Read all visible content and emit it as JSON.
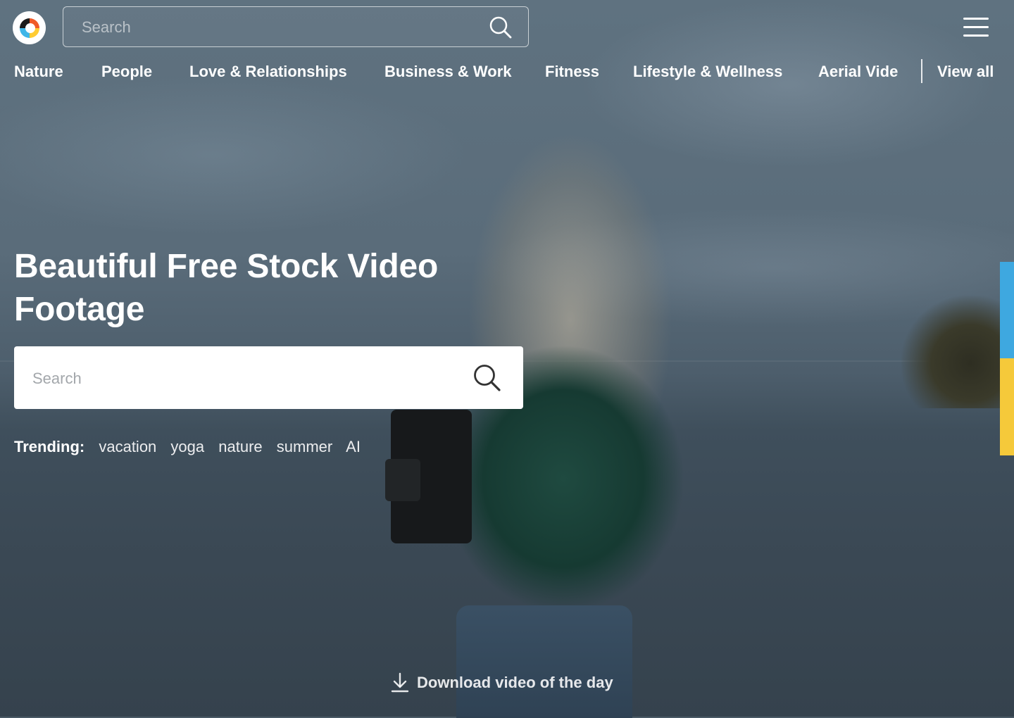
{
  "header": {
    "logo_name": "camera-logo-icon",
    "search": {
      "placeholder": "Search",
      "value": ""
    },
    "menu_icon": "hamburger-menu-icon"
  },
  "nav": {
    "items": [
      {
        "label": "Nature"
      },
      {
        "label": "People"
      },
      {
        "label": "Love & Relationships"
      },
      {
        "label": "Business & Work"
      },
      {
        "label": "Fitness"
      },
      {
        "label": "Lifestyle & Wellness"
      },
      {
        "label": "Aerial Vide"
      }
    ],
    "view_all": "View all"
  },
  "hero": {
    "title": "Beautiful Free Stock Video Footage",
    "search": {
      "placeholder": "Search",
      "value": ""
    },
    "trending_label": "Trending:",
    "trending_tags": [
      "vacation",
      "yoga",
      "nature",
      "summer",
      "AI"
    ],
    "download_label": "Download video of the day"
  },
  "colors": {
    "side_accent_blue": "#3ea8e0",
    "side_accent_yellow": "#f5c93a",
    "text": "#ffffff"
  }
}
